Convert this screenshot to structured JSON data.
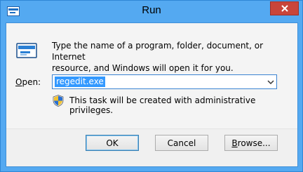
{
  "window": {
    "title": "Run"
  },
  "dialog": {
    "description_line1": "Type the name of a program, folder, document, or Internet",
    "description_line2": "resource, and Windows will open it for you.",
    "open_label_accel": "O",
    "open_label_rest": "pen:",
    "open_value": "regedit.exe",
    "admin_note": "This task will be created with administrative privileges."
  },
  "buttons": {
    "ok": "OK",
    "cancel": "Cancel",
    "browse_accel": "B",
    "browse_rest": "rowse..."
  },
  "icons": {
    "title": "run-app-icon",
    "app": "run-app-icon",
    "close": "close-icon",
    "dropdown": "chevron-down-icon",
    "shield": "uac-shield-icon"
  },
  "colors": {
    "titlebar": "#54a9f1",
    "close_button": "#c9453a",
    "selection": "#3399ff"
  }
}
